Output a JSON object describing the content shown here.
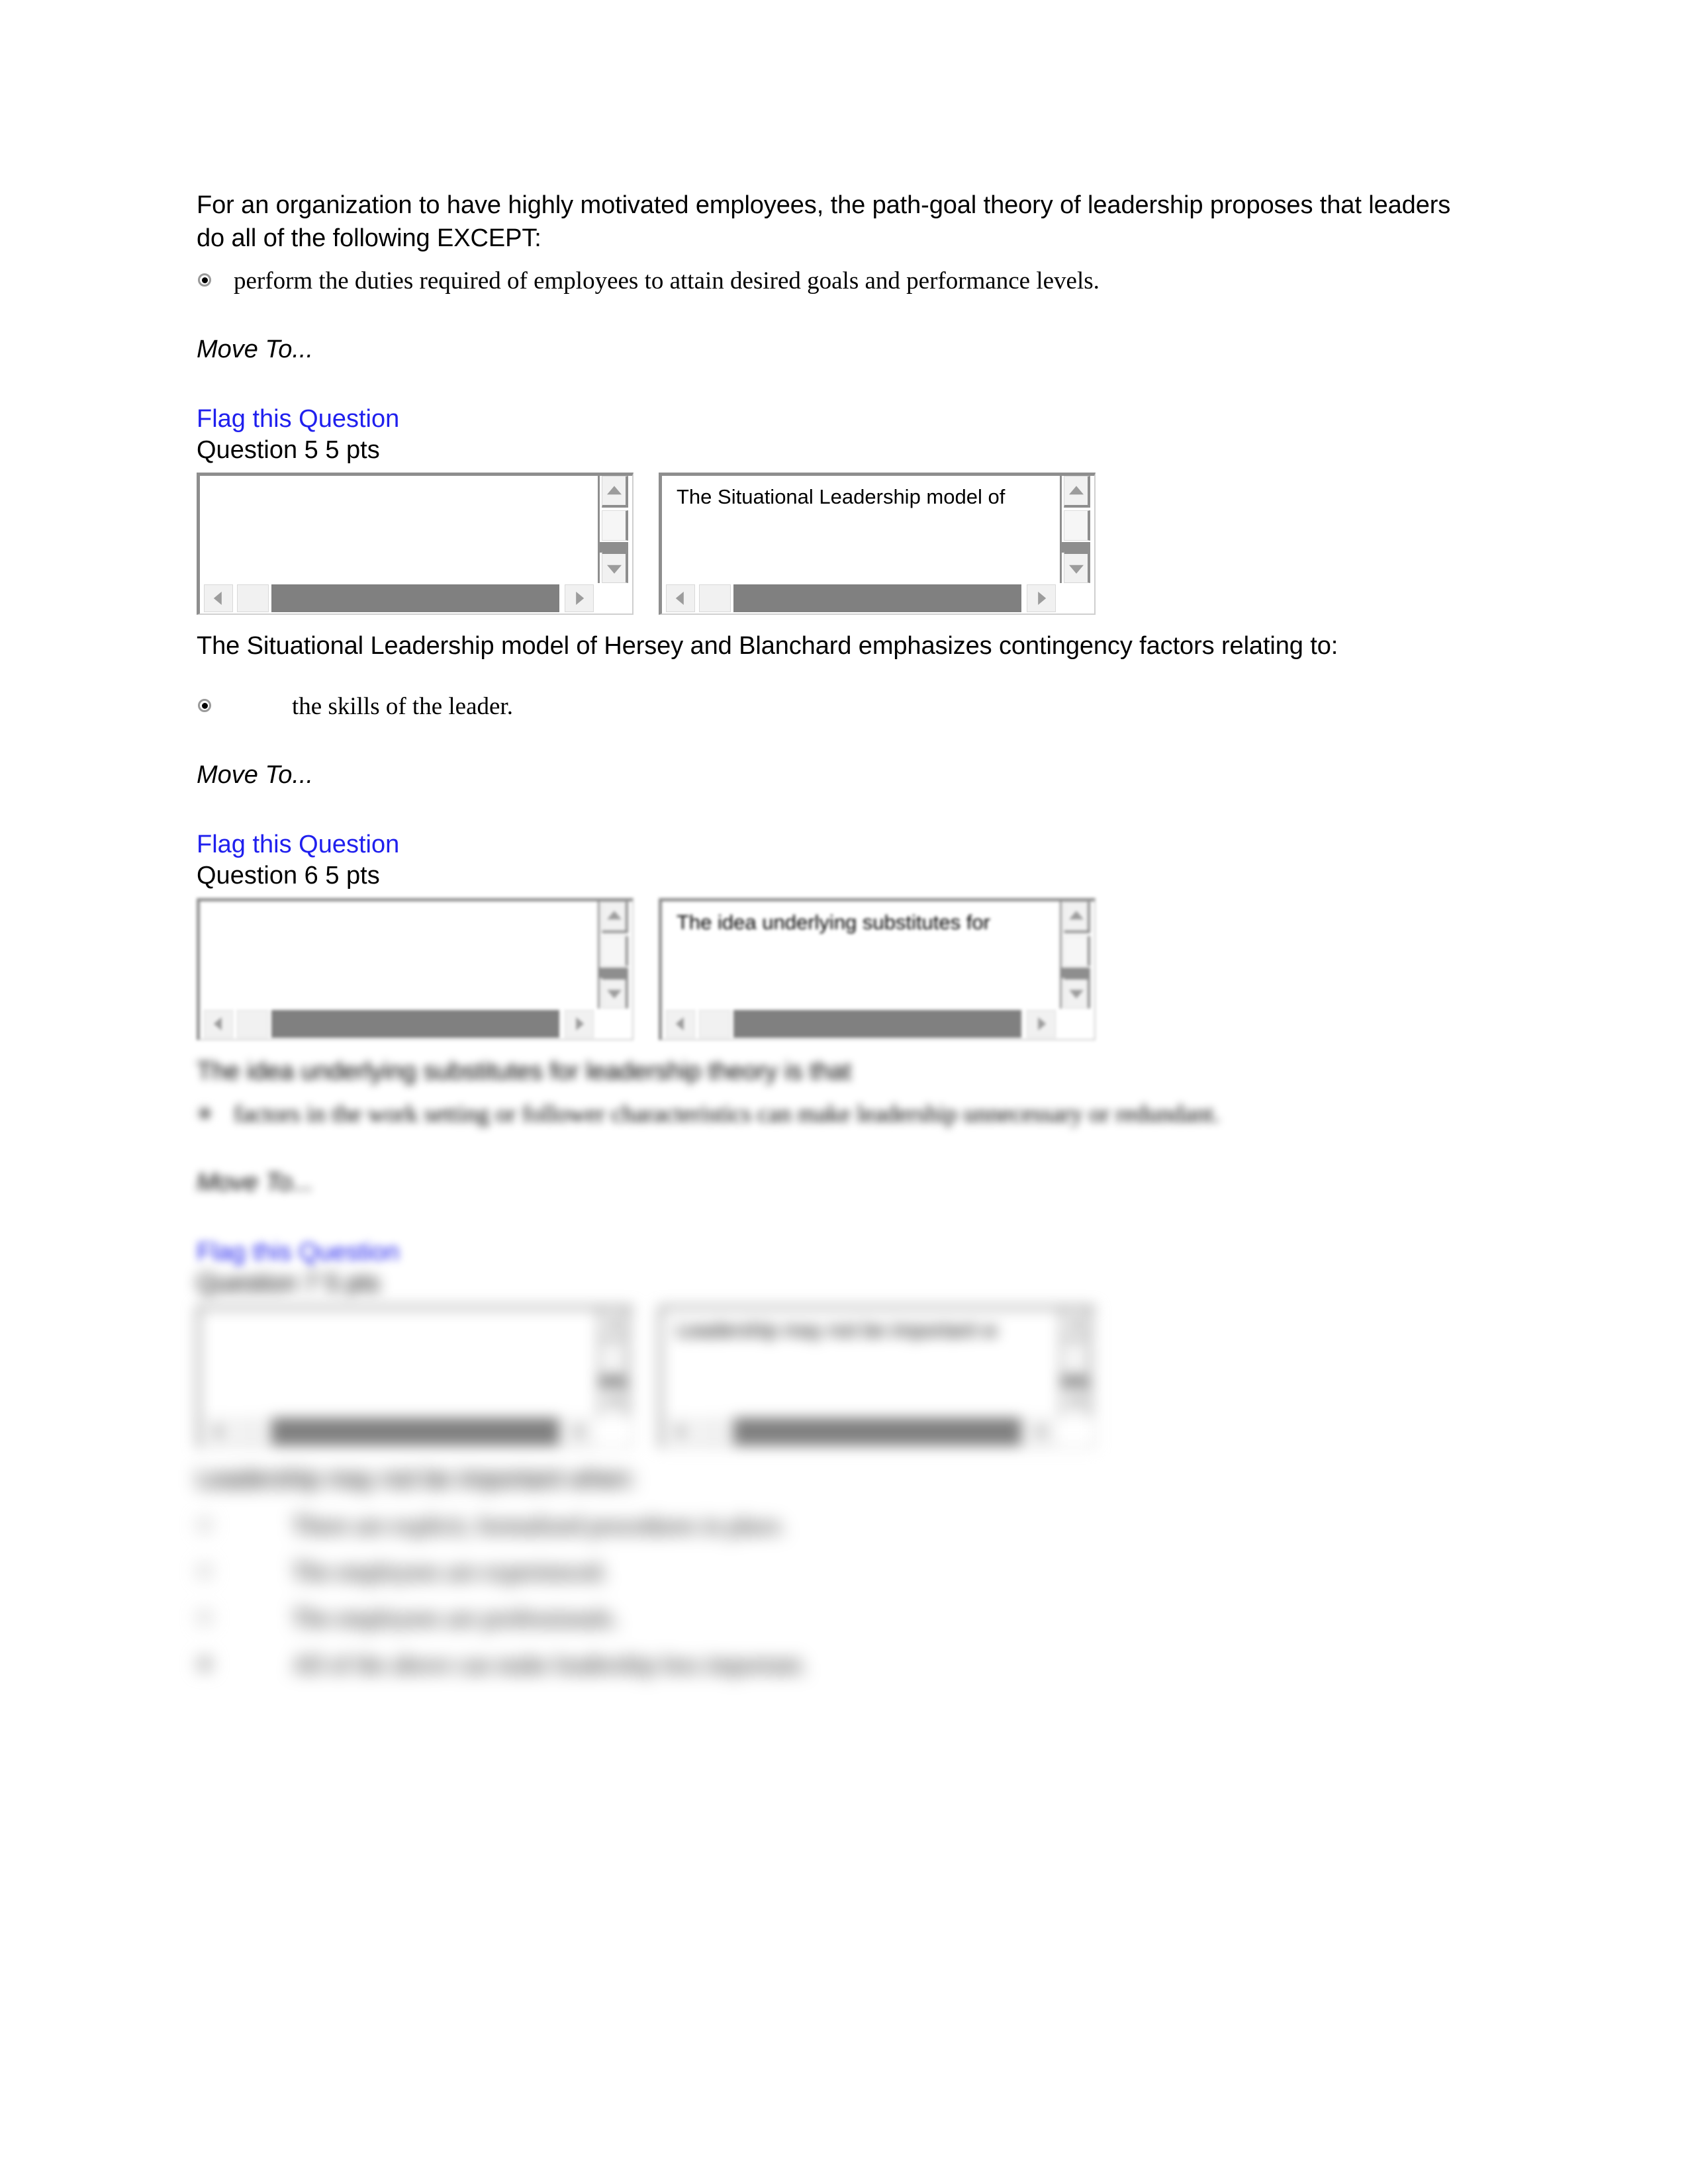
{
  "document": {
    "type": "online quiz printout",
    "page_background": "#ffffff",
    "link_color": "#2020ee",
    "text_color": "#000000"
  },
  "q4": {
    "stem": "For an organization to have highly motivated employees, the path-goal theory of leadership proposes that leaders do all of the following EXCEPT:",
    "options": [
      {
        "selected": true,
        "text": "perform the duties required of employees to attain desired goals and performance levels."
      }
    ],
    "move_to": "Move To...",
    "flag_label": "Flag this Question"
  },
  "q5": {
    "heading": "Question 5 5 pts",
    "widget": {
      "left_box_text": "",
      "right_box_text": "The Situational Leadership model of"
    },
    "stem": "The Situational Leadership model of Hersey and Blanchard emphasizes contingency factors relating to:",
    "options": [
      {
        "selected": true,
        "text": "the skills of the leader."
      }
    ],
    "move_to": "Move To...",
    "flag_label": "Flag this Question"
  },
  "q6": {
    "heading": "Question 6 5 pts",
    "widget": {
      "left_box_text": "",
      "right_box_text": "The idea underlying substitutes for"
    },
    "stem": "The idea underlying substitutes for leadership theory is that",
    "options": [
      {
        "selected": true,
        "text": "factors in the work setting or follower characteristics can make leadership unnecessary or redundant."
      }
    ],
    "move_to": "Move To...",
    "flag_label": "Flag this Question"
  },
  "q7": {
    "heading": "Question 7 5 pts",
    "widget": {
      "left_box_text": "",
      "right_box_text": "Leadership may not be important w"
    },
    "stem": "Leadership may not be important when:",
    "options": [
      {
        "selected": false,
        "text": "There are explicit, formalized procedures in place."
      },
      {
        "selected": false,
        "text": "The employees are experienced."
      },
      {
        "selected": false,
        "text": "The employees are professionals."
      },
      {
        "selected": true,
        "text": "All of the above can make leadership less important."
      }
    ]
  },
  "icons": {
    "radio_selected": "radio-button-selected-icon",
    "radio_empty": "radio-button-icon",
    "scroll_up": "scroll-up-arrow-icon",
    "scroll_down": "scroll-down-arrow-icon",
    "scroll_left": "scroll-left-arrow-icon",
    "scroll_right": "scroll-right-arrow-icon"
  }
}
